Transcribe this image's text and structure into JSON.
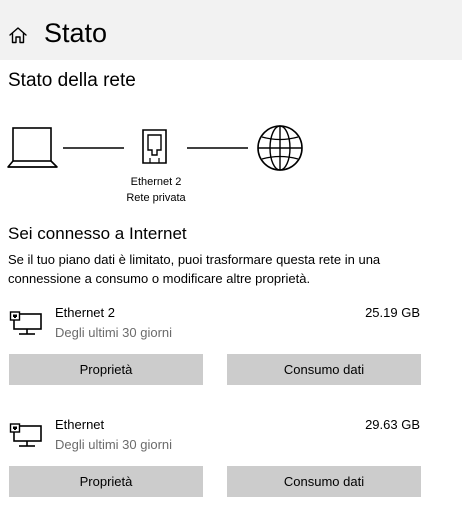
{
  "header": {
    "title": "Stato",
    "home_icon": "home-icon"
  },
  "network_status": {
    "title": "Stato della rete",
    "diagram": {
      "computer_icon": "laptop-icon",
      "adapter_icon": "ethernet-port-icon",
      "internet_icon": "globe-icon",
      "adapter_name": "Ethernet 2",
      "network_type": "Rete privata"
    }
  },
  "connection": {
    "title": "Sei connesso a Internet",
    "description": "Se il tuo piano dati è limitato, puoi trasformare questa rete in una connessione a consumo o modificare altre proprietà."
  },
  "adapters": [
    {
      "name": "Ethernet 2",
      "period": "Degli ultimi 30 giorni",
      "usage": "25.19 GB",
      "icon": "ethernet-adapter-icon",
      "properties_label": "Proprietà",
      "data_usage_label": "Consumo dati"
    },
    {
      "name": "Ethernet",
      "period": "Degli ultimi 30 giorni",
      "usage": "29.63 GB",
      "icon": "ethernet-adapter-icon",
      "properties_label": "Proprietà",
      "data_usage_label": "Consumo dati"
    }
  ]
}
